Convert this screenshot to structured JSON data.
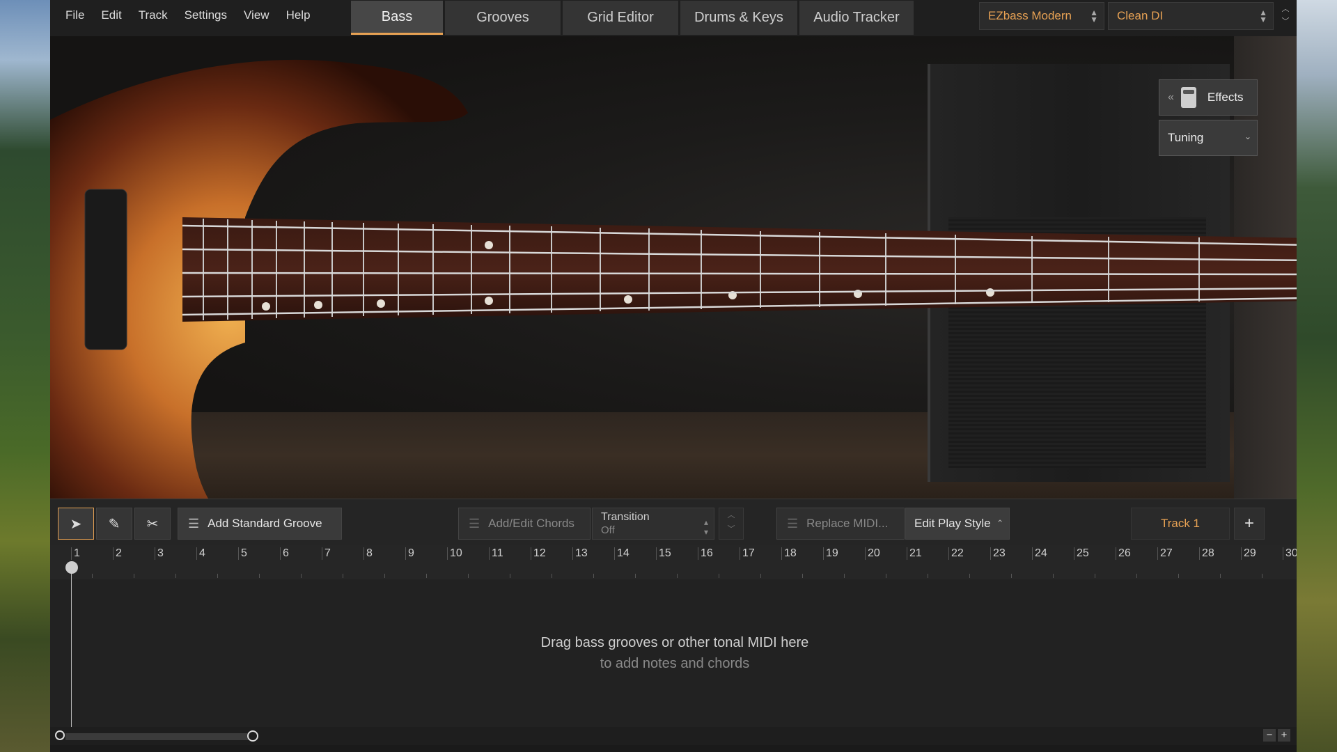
{
  "menu": [
    "File",
    "Edit",
    "Track",
    "Settings",
    "View",
    "Help"
  ],
  "tabs": [
    {
      "label": "Bass",
      "active": true
    },
    {
      "label": "Grooves",
      "active": false
    },
    {
      "label": "Grid Editor",
      "active": false
    },
    {
      "label": "Drums & Keys",
      "active": false
    },
    {
      "label": "Audio Tracker",
      "active": false
    }
  ],
  "instrument_select": "EZbass Modern",
  "preset_select": "Clean DI",
  "effects_label": "Effects",
  "tuning_label": "Tuning",
  "toolbar": {
    "add_standard_groove": "Add Standard Groove",
    "add_edit_chords": "Add/Edit Chords",
    "transition_label": "Transition",
    "transition_value": "Off",
    "replace_midi": "Replace MIDI...",
    "edit_play_style": "Edit Play Style",
    "track_name": "Track 1",
    "add_track": "+"
  },
  "ruler_bars": [
    "1",
    "2",
    "3",
    "4",
    "5",
    "6",
    "7",
    "8",
    "9",
    "10",
    "11",
    "12",
    "13",
    "14",
    "15",
    "16",
    "17",
    "18",
    "19",
    "20",
    "21",
    "22",
    "23",
    "24",
    "25",
    "26",
    "27",
    "28",
    "29",
    "30"
  ],
  "drop_hint": {
    "main": "Drag bass grooves or other tonal MIDI here",
    "sub": "to add notes and chords"
  },
  "zoom": {
    "minus": "−",
    "plus": "+"
  },
  "colors": {
    "accent": "#e8a254",
    "background": "#242424",
    "tab_active": "#474747"
  }
}
